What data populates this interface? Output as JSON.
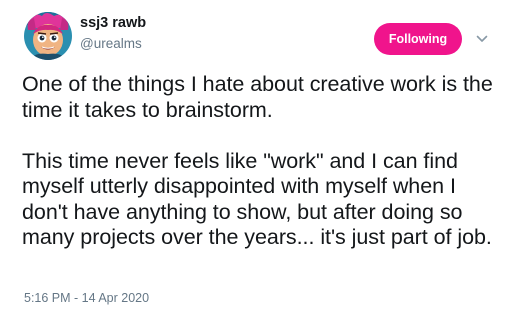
{
  "tweet": {
    "author": {
      "display_name": "ssj3 rawb",
      "handle": "@urealms",
      "avatar": "avatar-illustrated-character"
    },
    "follow_button": {
      "label": "Following",
      "color": "#f0148c"
    },
    "menu_icon": "chevron-down-icon",
    "text": "One of the things I hate about creative work is the time it takes to brainstorm.\n\nThis time never feels like \"work\" and I can find myself utterly disappointed with myself when I don't have anything to show, but after doing so many projects over the years... it's just part of job.",
    "timestamp": "5:16 PM - 14 Apr 2020"
  },
  "colors": {
    "text_primary": "#14171a",
    "text_secondary": "#657786",
    "accent": "#f0148c"
  }
}
